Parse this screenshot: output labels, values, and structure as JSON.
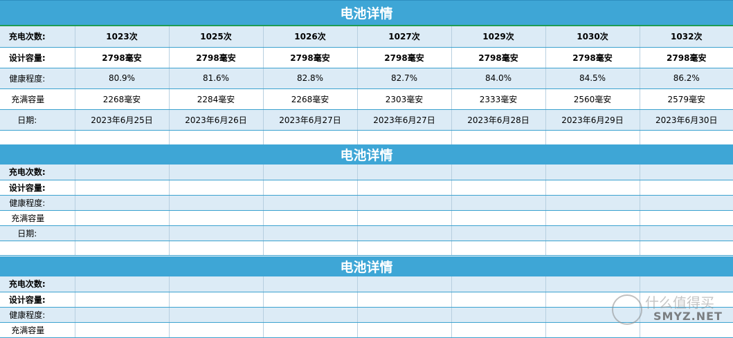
{
  "section1": {
    "title": "电池详情",
    "rows": [
      {
        "label": "充电次数:",
        "values": [
          "1023次",
          "1025次",
          "1026次",
          "1027次",
          "1029次",
          "1030次",
          "1032次"
        ]
      },
      {
        "label": "设计容量:",
        "values": [
          "2798毫安",
          "2798毫安",
          "2798毫安",
          "2798毫安",
          "2798毫安",
          "2798毫安",
          "2798毫安"
        ]
      },
      {
        "label": "健康程度:",
        "values": [
          "80.9%",
          "81.6%",
          "82.8%",
          "82.7%",
          "84.0%",
          "84.5%",
          "86.2%"
        ]
      },
      {
        "label": "充满容量",
        "values": [
          "2268毫安",
          "2284毫安",
          "2268毫安",
          "2303毫安",
          "2333毫安",
          "2560毫安",
          "2579毫安"
        ]
      },
      {
        "label": "日期:",
        "values": [
          "2023年6月25日",
          "2023年6月26日",
          "2023年6月27日",
          "2023年6月27日",
          "2023年6月28日",
          "2023年6月29日",
          "2023年6月30日"
        ]
      }
    ]
  },
  "section2": {
    "title": "电池详情",
    "labels": [
      "充电次数:",
      "设计容量:",
      "健康程度:",
      "充满容量",
      "日期:"
    ]
  },
  "section3": {
    "title": "电池详情",
    "labels": [
      "充电次数:",
      "设计容量:",
      "健康程度:",
      "充满容量"
    ]
  },
  "watermark": {
    "brand": "什么值得买",
    "domain": "SMYZ.NET"
  }
}
